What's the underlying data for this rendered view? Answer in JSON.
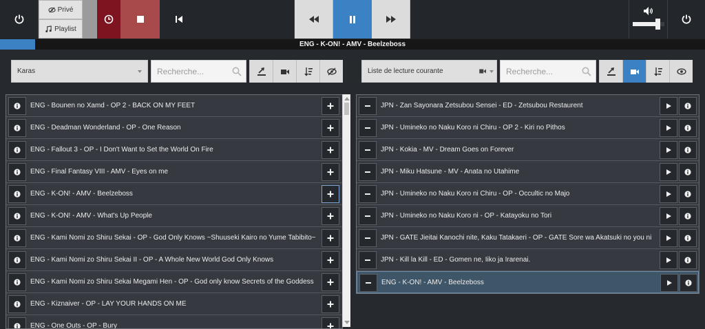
{
  "player": {
    "mode_private": "Privé",
    "mode_playlist": "Playlist",
    "now_playing": "ENG - K-ON! - AMV - Beelzeboss",
    "progress_percent": 5,
    "volume_percent": 80
  },
  "left_panel": {
    "source_select": "Karas",
    "search_placeholder": "Recherche...",
    "items": [
      "ENG - Bounen no Xamd - OP 2 - BACK ON MY FEET",
      "ENG - Deadman Wonderland - OP - One Reason",
      "ENG - Fallout 3 - OP - I Don't Want to Set the World On Fire",
      "ENG - Final Fantasy VIII - AMV - Eyes on me",
      "ENG - K-ON! - AMV - Beelzeboss",
      "ENG - K-ON! - AMV - What's Up People",
      "ENG - Kami Nomi zo Shiru Sekai - OP - God Only Knows ~Shuuseki Kairo no Yume Tabibito~",
      "ENG - Kami Nomi zo Shiru Sekai II - OP - A Whole New World God Only Knows",
      "ENG - Kami Nomi zo Shiru Sekai Megami Hen - OP - God only know Secrets of the Goddess",
      "ENG - Kiznaiver - OP - LAY YOUR HANDS ON ME",
      "ENG - One Outs - OP - Bury"
    ]
  },
  "right_panel": {
    "playlist_select": "Liste de lecture courante",
    "search_placeholder": "Recherche...",
    "items": [
      "JPN - Zan Sayonara Zetsubou Sensei - ED - Zetsubou Restaurent",
      "JPN - Umineko no Naku Koro ni Chiru - OP 2 - Kiri no Pithos",
      "JPN - Kokia - MV - Dream Goes on Forever",
      "JPN - Miku Hatsune - MV - Anata no Utahime",
      "JPN - Umineko no Naku Koro ni Chiru - OP - Occultic no Majo",
      "JPN - Umineko no Naku Koro ni - OP - Katayoku no Tori",
      "JPN - GATE Jieitai Kanochi nite, Kaku Tatakaeri - OP - GATE Sore wa Akatsuki no you ni",
      "JPN - Kill la Kill - ED - Gomen ne, Iiko ja Irarenai.",
      "ENG - K-ON! - AMV - Beelzeboss"
    ]
  },
  "colors": {
    "accent": "#3b82c4",
    "stop": "#a84a4c",
    "history": "#7e1420"
  }
}
